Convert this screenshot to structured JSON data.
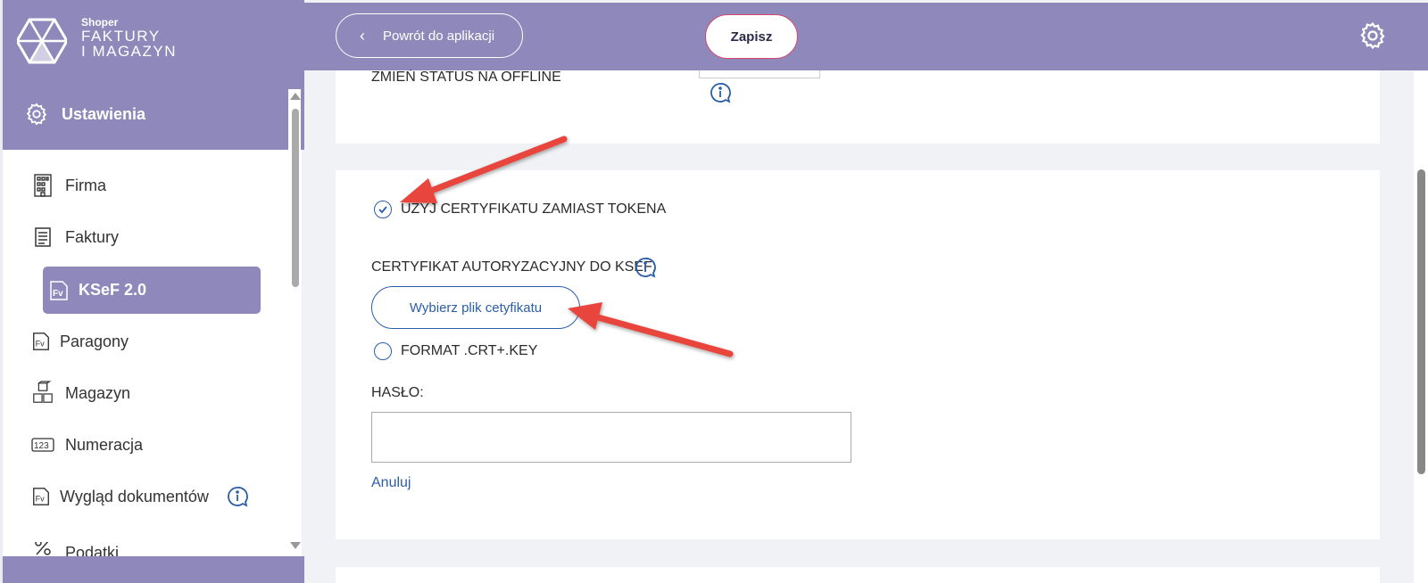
{
  "app": {
    "brand_small": "Shoper",
    "brand_line1": "FAKTURY",
    "brand_line2": "I MAGAZYN"
  },
  "sidebar": {
    "section_title": "Ustawienia",
    "items": [
      {
        "label": "Firma",
        "icon": "building-icon"
      },
      {
        "label": "Faktury",
        "icon": "document-list-icon"
      },
      {
        "label": "KSeF 2.0",
        "icon": "invoice-fv-icon",
        "active": true
      },
      {
        "label": "Paragony",
        "icon": "invoice-fv-icon"
      },
      {
        "label": "Magazyn",
        "icon": "boxes-icon"
      },
      {
        "label": "Numeracja",
        "icon": "numbering-icon"
      },
      {
        "label": "Wygląd dokumentów",
        "icon": "invoice-fv-icon"
      },
      {
        "label": "Podatki",
        "icon": "percent-icon"
      }
    ]
  },
  "header": {
    "back_label": "Powrót do aplikacji",
    "save_label": "Zapisz"
  },
  "form": {
    "offline_label": "ZMIEŃ STATUS NA OFFLINE",
    "use_cert_label": "UŻYJ CERTYFIKATU ZAMIAST TOKENA",
    "use_cert_checked": true,
    "cert_label": "CERTYFIKAT AUTORYZACYJNY DO KSEF:",
    "file_button": "Wybierz plik cetyfikatu",
    "format_label": "FORMAT .CRT+.KEY",
    "format_checked": false,
    "password_label": "HASŁO:",
    "password_value": "",
    "cancel_label": "Anuluj"
  },
  "colors": {
    "brand_purple": "#8e88bb",
    "link_blue": "#2b5ea8",
    "save_border": "#d7456b",
    "annotation_red": "#e8453c"
  }
}
